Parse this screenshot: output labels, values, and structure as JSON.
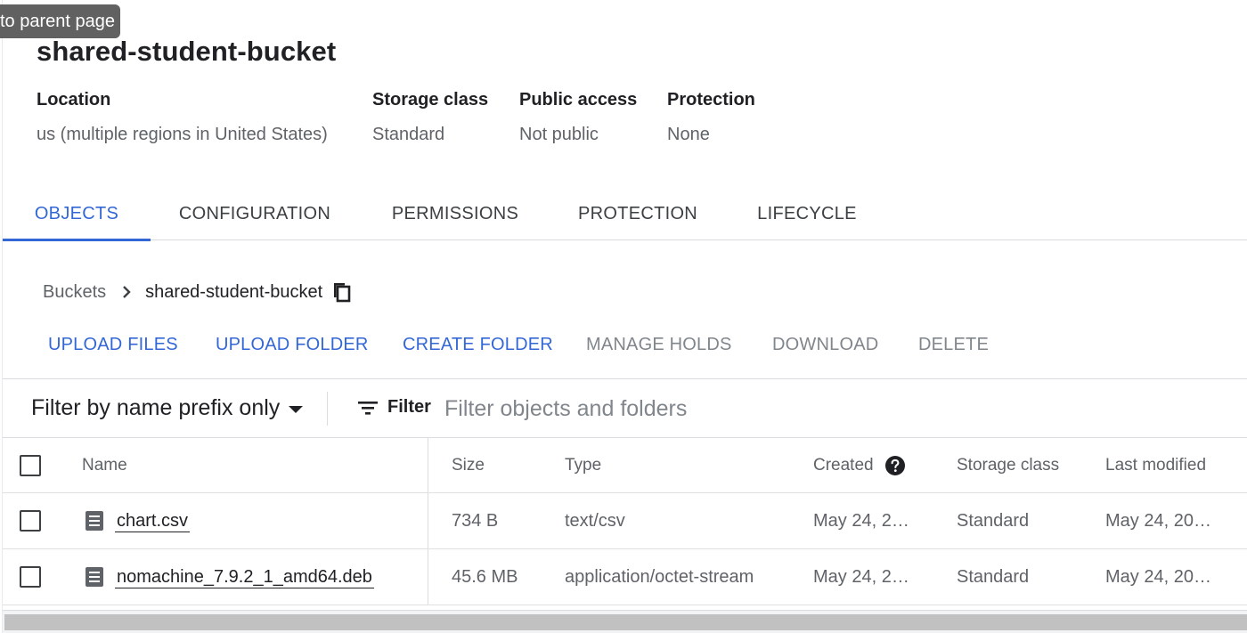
{
  "tooltip": {
    "text": "to parent page"
  },
  "bucket": {
    "title": "shared-student-bucket",
    "info": [
      {
        "label": "Location",
        "value": "us (multiple regions in United States)"
      },
      {
        "label": "Storage class",
        "value": "Standard"
      },
      {
        "label": "Public access",
        "value": "Not public"
      },
      {
        "label": "Protection",
        "value": "None"
      }
    ]
  },
  "tabs": [
    {
      "label": "OBJECTS",
      "active": true
    },
    {
      "label": "CONFIGURATION",
      "active": false
    },
    {
      "label": "PERMISSIONS",
      "active": false
    },
    {
      "label": "PROTECTION",
      "active": false
    },
    {
      "label": "LIFECYCLE",
      "active": false
    }
  ],
  "breadcrumb": {
    "root": "Buckets",
    "current": "shared-student-bucket",
    "separator_icon": "chevron-right-icon",
    "copy_icon": "copy-icon"
  },
  "actions": [
    {
      "label": "UPLOAD FILES",
      "enabled": true
    },
    {
      "label": "UPLOAD FOLDER",
      "enabled": true
    },
    {
      "label": "CREATE FOLDER",
      "enabled": true
    },
    {
      "label": "MANAGE HOLDS",
      "enabled": false
    },
    {
      "label": "DOWNLOAD",
      "enabled": false
    },
    {
      "label": "DELETE",
      "enabled": false
    }
  ],
  "filter": {
    "mode_label": "Filter by name prefix only",
    "button_label": "Filter",
    "placeholder": "Filter objects and folders"
  },
  "table": {
    "columns": [
      "Name",
      "Size",
      "Type",
      "Created",
      "Storage class",
      "Last modified"
    ],
    "rows": [
      {
        "name": "chart.csv",
        "size": "734 B",
        "type": "text/csv",
        "created": "May 24, 2…",
        "storage_class": "Standard",
        "last_modified": "May 24, 20…"
      },
      {
        "name": "nomachine_7.9.2_1_amd64.deb",
        "size": "45.6 MB",
        "type": "application/octet-stream",
        "created": "May 24, 2…",
        "storage_class": "Standard",
        "last_modified": "May 24, 20…"
      }
    ]
  },
  "colors": {
    "accent": "#3367d6",
    "text_primary": "#202124",
    "text_secondary": "#5f6368",
    "disabled": "#80868b",
    "divider": "#dadce0"
  }
}
